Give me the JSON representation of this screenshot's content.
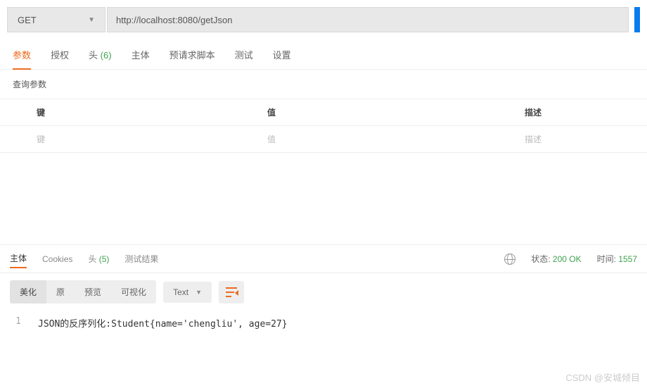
{
  "request": {
    "method": "GET",
    "url": "http://localhost:8080/getJson"
  },
  "tabs": {
    "params": "参数",
    "auth": "授权",
    "headers_label": "头",
    "headers_count": "(6)",
    "body": "主体",
    "prerequest": "预请求脚本",
    "tests": "测试",
    "settings": "设置"
  },
  "params_section": {
    "title": "查询参数",
    "col_key": "键",
    "col_val": "值",
    "col_desc": "描述",
    "ph_key": "键",
    "ph_val": "值",
    "ph_desc": "描述"
  },
  "response_tabs": {
    "body": "主体",
    "cookies": "Cookies",
    "headers_label": "头",
    "headers_count": "(5)",
    "results": "测试结果"
  },
  "status": {
    "state_label": "状态:",
    "state_value": "200 OK",
    "time_label": "时间:",
    "time_value": "1557"
  },
  "view_modes": {
    "pretty": "美化",
    "raw": "原",
    "preview": "预览",
    "visualize": "可视化",
    "type": "Text"
  },
  "response_body": {
    "line_no": "1",
    "content": "JSON的反序列化:Student{name='chengliu', age=27}"
  },
  "watermark": "CSDN @安城倾目"
}
